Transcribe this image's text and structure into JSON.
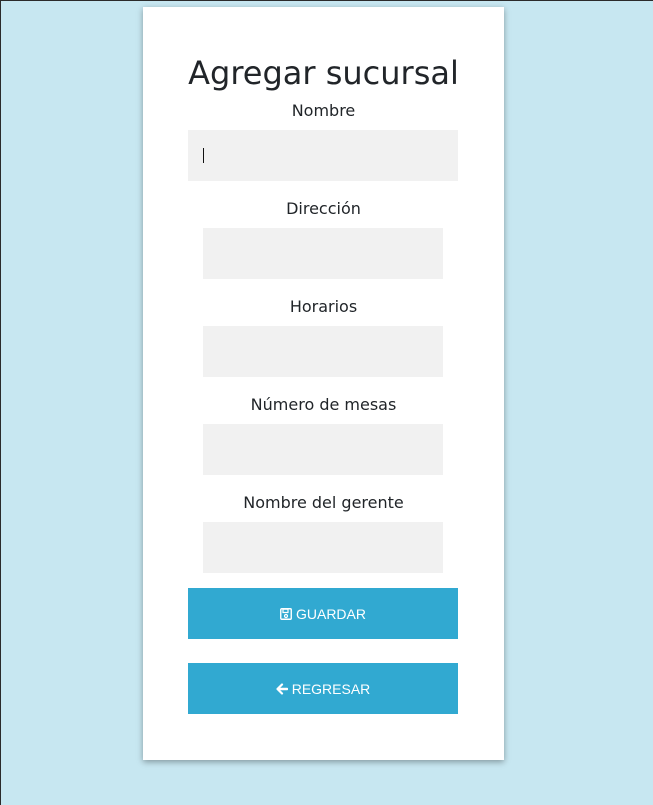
{
  "form": {
    "title": "Agregar sucursal",
    "fields": [
      {
        "label": "Nombre",
        "value": ""
      },
      {
        "label": "Dirección",
        "value": ""
      },
      {
        "label": "Horarios",
        "value": ""
      },
      {
        "label": "Número de mesas",
        "value": ""
      },
      {
        "label": "Nombre del gerente",
        "value": ""
      }
    ],
    "save_button": {
      "label": "GUARDAR",
      "icon": "floppy-disk-icon"
    },
    "back_button": {
      "label": "REGRESAR",
      "icon": "arrow-left-icon"
    }
  },
  "colors": {
    "background": "#c7e7f1",
    "card": "#ffffff",
    "field_bg": "#f1f1f1",
    "button": "#31a9d1",
    "text": "#212529"
  }
}
